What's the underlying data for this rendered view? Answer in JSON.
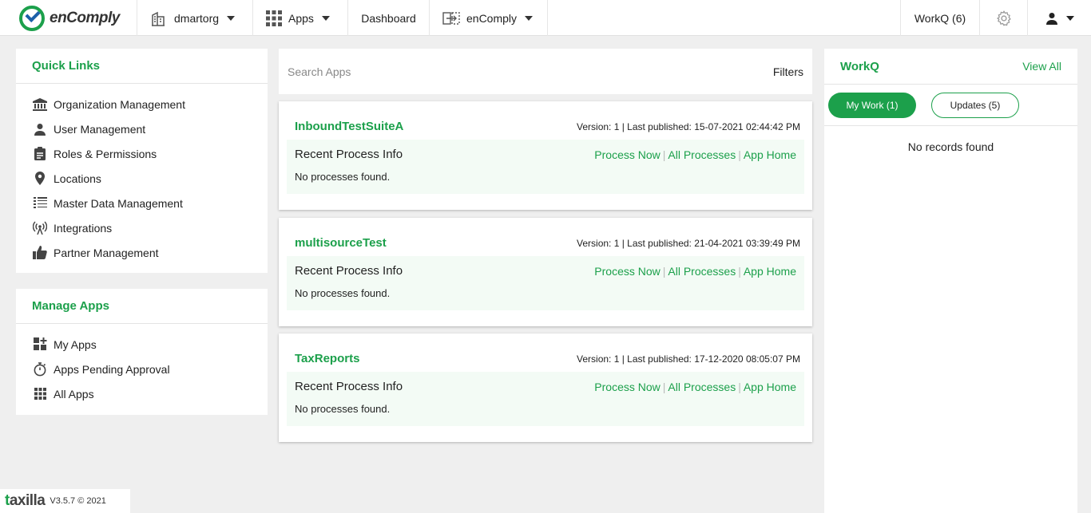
{
  "nav": {
    "logo_text": "enComply",
    "org": "dmartorg",
    "apps": "Apps",
    "dashboard": "Dashboard",
    "product": "enComply",
    "workq": "WorkQ (6)"
  },
  "quick_links": {
    "title": "Quick Links",
    "items": [
      {
        "label": "Organization Management",
        "icon": "bank-icon"
      },
      {
        "label": "User Management",
        "icon": "user-icon"
      },
      {
        "label": "Roles & Permissions",
        "icon": "clipboard-icon"
      },
      {
        "label": "Locations",
        "icon": "map-pin-icon"
      },
      {
        "label": "Master Data Management",
        "icon": "list-icon"
      },
      {
        "label": "Integrations",
        "icon": "broadcast-icon"
      },
      {
        "label": "Partner Management",
        "icon": "thumbs-up-icon"
      }
    ]
  },
  "manage_apps": {
    "title": "Manage Apps",
    "items": [
      {
        "label": "My Apps",
        "icon": "apps-plus-icon"
      },
      {
        "label": "Apps Pending Approval",
        "icon": "stopwatch-icon"
      },
      {
        "label": "All Apps",
        "icon": "grid-icon"
      }
    ]
  },
  "search": {
    "placeholder": "Search Apps",
    "filters": "Filters"
  },
  "apps": [
    {
      "name": "InboundTestSuiteA",
      "meta": "Version: 1 | Last published: 15-07-2021 02:44:42 PM"
    },
    {
      "name": "multisourceTest",
      "meta": "Version: 1 | Last published: 21-04-2021 03:39:49 PM"
    },
    {
      "name": "TaxReports",
      "meta": "Version: 1 | Last published: 17-12-2020 08:05:07 PM"
    }
  ],
  "card_labels": {
    "recent": "Recent Process Info",
    "process_now": "Process Now",
    "all_processes": "All Processes",
    "app_home": "App Home",
    "sep": "|",
    "no_processes": "No processes found."
  },
  "workq": {
    "title": "WorkQ",
    "view_all": "View All",
    "tab_my_work": "My Work (1)",
    "tab_updates": "Updates (5)",
    "empty": "No records found"
  },
  "footer": {
    "brand_t": "t",
    "brand_rest": "axilla",
    "version": "V3.5.7 © 2021"
  },
  "colors": {
    "accent": "#1ca04b",
    "logo_blue": "#1c5fa8",
    "background": "#efefef"
  }
}
